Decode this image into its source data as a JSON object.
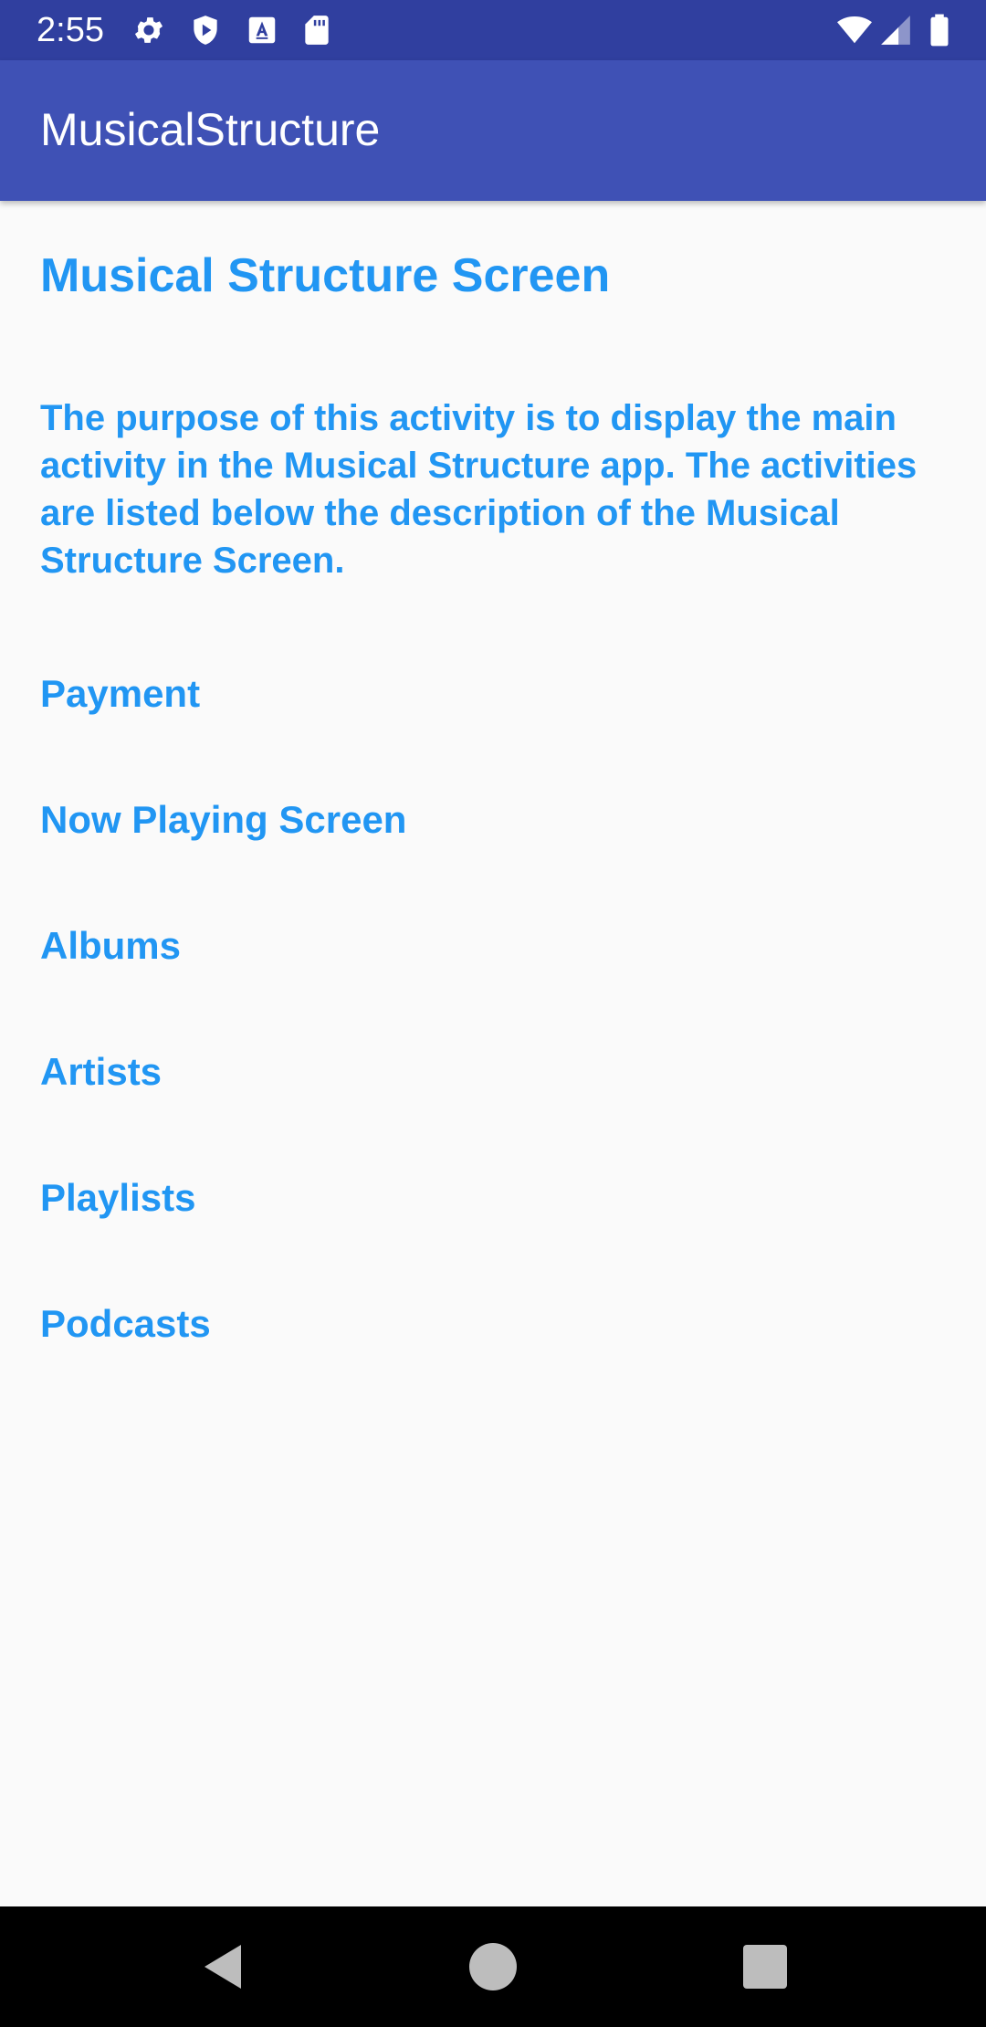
{
  "status_bar": {
    "time": "2:55",
    "left_icons": [
      "gear-icon",
      "shield-play-icon",
      "text-a-icon",
      "sd-card-icon"
    ],
    "right_icons": [
      "wifi-icon",
      "cellular-signal-icon",
      "battery-icon"
    ],
    "background": "#303f9f"
  },
  "app_bar": {
    "title": "MusicalStructure",
    "background": "#3f51b5"
  },
  "main": {
    "heading": "Musical Structure Screen",
    "description": "The purpose of this activity is to display the main activity in the Musical Structure app. The activities are listed below the description of the Musical Structure Screen.",
    "items": [
      {
        "label": "Payment"
      },
      {
        "label": "Now Playing Screen"
      },
      {
        "label": "Albums"
      },
      {
        "label": "Artists"
      },
      {
        "label": "Playlists"
      },
      {
        "label": "Podcasts"
      }
    ],
    "accent_color": "#2196f3"
  },
  "nav_bar": {
    "buttons": [
      "back-icon",
      "home-icon",
      "recents-icon"
    ]
  }
}
